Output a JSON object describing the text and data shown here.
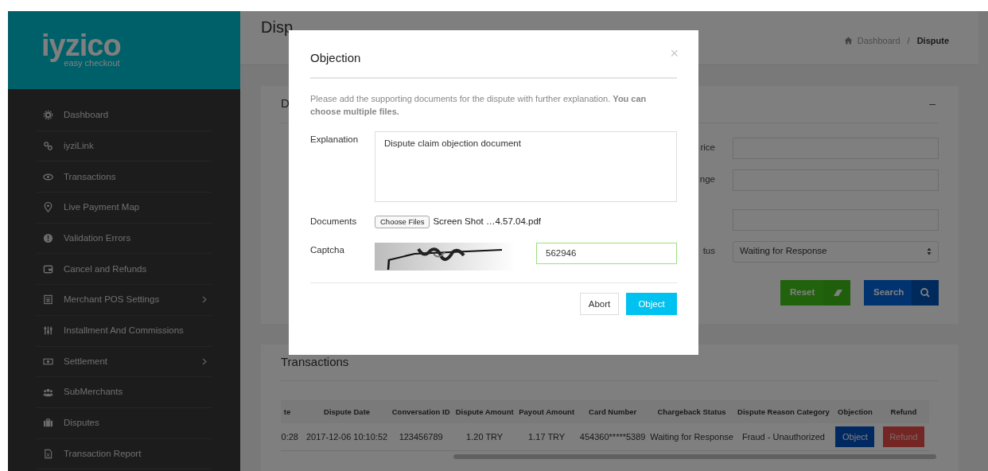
{
  "logo": {
    "name": "iyzico",
    "tagline": "easy checkout"
  },
  "sidebar": {
    "items": [
      {
        "label": "Dashboard",
        "expandable": false
      },
      {
        "label": "iyziLink",
        "expandable": false
      },
      {
        "label": "Transactions",
        "expandable": false
      },
      {
        "label": "Live Payment Map",
        "expandable": false
      },
      {
        "label": "Validation Errors",
        "expandable": false
      },
      {
        "label": "Cancel and Refunds",
        "expandable": false
      },
      {
        "label": "Merchant POS Settings",
        "expandable": true
      },
      {
        "label": "Installment And Commissions",
        "expandable": false
      },
      {
        "label": "Settlement",
        "expandable": true
      },
      {
        "label": "SubMerchants",
        "expandable": false
      },
      {
        "label": "Disputes",
        "expandable": false
      },
      {
        "label": "Transaction Report",
        "expandable": false
      }
    ]
  },
  "page_title": "Disp",
  "breadcrumb": [
    {
      "label": "Dashboard",
      "current": false
    },
    {
      "separator": "/",
      "label": "Dispute",
      "current": true
    }
  ],
  "filter_card": {
    "title": "D",
    "collapse": "–",
    "fields": [
      {
        "label": "rice",
        "kind": "input"
      },
      {
        "label": "nge",
        "kind": "input"
      },
      {
        "kind": "input"
      },
      {
        "label": "tus",
        "kind": "select",
        "value": "Waiting for Response"
      }
    ],
    "buttons": [
      {
        "label": "Reset",
        "kind": "reset"
      },
      {
        "label": "Search",
        "kind": "search"
      }
    ]
  },
  "transactions": {
    "title": "Transactions",
    "columns": [
      "te",
      "Dispute Date",
      "Conversation ID",
      "Dispute Amount",
      "Payout Amount",
      "Card Number",
      "Chargeback Status",
      "Dispute Reason Category",
      "Objection",
      "Refund"
    ],
    "rows": [
      {
        "cells": [
          "0:28",
          "2017-12-06 10:10:52",
          "123456789",
          "1.20 TRY",
          "1.17 TRY",
          "454360*****5389",
          "Waiting for Response",
          "Fraud - Unauthorized"
        ],
        "objection": "Object",
        "refund": "Refund"
      }
    ]
  },
  "modal": {
    "title": "Objection",
    "close": "×",
    "intro": "Please add the supporting documents for the dispute with further explanation. **You can choose multiple files.**",
    "explanation_label": "Explanation",
    "explanation": "Dispute claim objection document",
    "documents_label": "Documents",
    "choose_button": "Choose Files",
    "file_name": "Screen Shot …4.57.04.pdf",
    "captcha_label": "Captcha",
    "captcha_value": "562946",
    "captcha_valid": true,
    "buttons": [
      {
        "label": "Abort",
        "kind": "default"
      },
      {
        "label": "Object",
        "kind": "primary"
      }
    ]
  }
}
